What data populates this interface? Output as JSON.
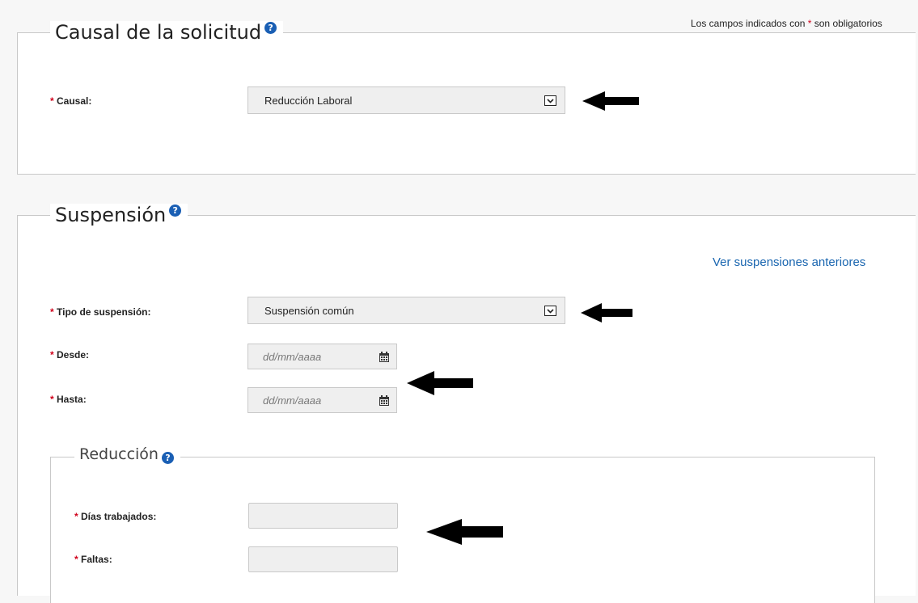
{
  "required_note": {
    "prefix": "Los campos indicados con ",
    "star": "*",
    "suffix": " son obligatorios"
  },
  "causal_section": {
    "title": "Causal de la solicitud",
    "help": "?",
    "field": {
      "star": "*",
      "label": "Causal:",
      "value": "Reducción Laboral"
    }
  },
  "suspension_section": {
    "title": "Suspensión",
    "help": "?",
    "link": "Ver suspensiones anteriores",
    "tipo": {
      "star": "*",
      "label": "Tipo de suspensión:",
      "value": "Suspensión común"
    },
    "desde": {
      "star": "*",
      "label": "Desde:",
      "placeholder": "dd/mm/aaaa"
    },
    "hasta": {
      "star": "*",
      "label": "Hasta:",
      "placeholder": "dd/mm/aaaa"
    }
  },
  "reduccion_section": {
    "title": "Reducción",
    "help": "?",
    "dias": {
      "star": "*",
      "label": "Días trabajados:",
      "value": ""
    },
    "faltas": {
      "star": "*",
      "label": "Faltas:",
      "value": ""
    }
  },
  "icons": {
    "help": "help-icon",
    "dropdown": "chevron-down-icon",
    "calendar": "calendar-icon",
    "annotation": "arrow-left-icon"
  },
  "colors": {
    "accent": "#1a5fb4",
    "link": "#1a66b0",
    "required": "#d0021b",
    "field_bg": "#efefef"
  }
}
